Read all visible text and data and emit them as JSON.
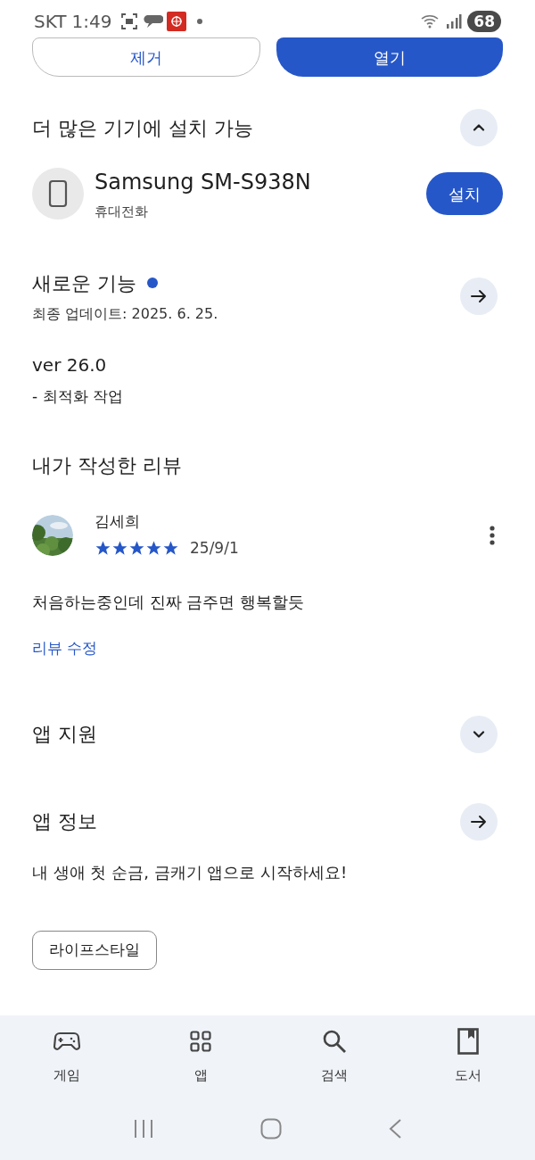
{
  "status_bar": {
    "carrier": "SKT",
    "time": "1:49",
    "battery": "68"
  },
  "top_buttons": [
    {
      "label": "제거",
      "kind": "outline"
    },
    {
      "label": "열기",
      "kind": "filled"
    }
  ],
  "devices_section": {
    "title": "더 많은 기기에 설치 가능",
    "expanded": true,
    "device": {
      "name": "Samsung SM-S938N",
      "type": "휴대전화",
      "button": "설치"
    }
  },
  "whats_new": {
    "title": "새로운 기능",
    "updated": "최종 업데이트: 2025. 6. 25.",
    "version": "ver 26.0",
    "notes": "- 최적화 작업"
  },
  "my_review": {
    "title": "내가 작성한 리뷰",
    "author": "김세희",
    "stars": 5,
    "date": "25/9/1",
    "text": "처음하는중인데 진짜 금주면 행복할듯",
    "edit_link": "리뷰 수정"
  },
  "sections": [
    {
      "title": "앱 지원",
      "kind": "expand",
      "expanded": false
    },
    {
      "title": "앱 정보",
      "kind": "arrow",
      "description": "내 생애 첫 순금, 금캐기 앱으로 시작하세요!"
    }
  ],
  "tags": [
    "라이프스타일"
  ],
  "bottom_nav": [
    {
      "label": "게임",
      "kind": "games"
    },
    {
      "label": "앱",
      "kind": "apps"
    },
    {
      "label": "검색",
      "kind": "search"
    },
    {
      "label": "도서",
      "kind": "books"
    }
  ]
}
